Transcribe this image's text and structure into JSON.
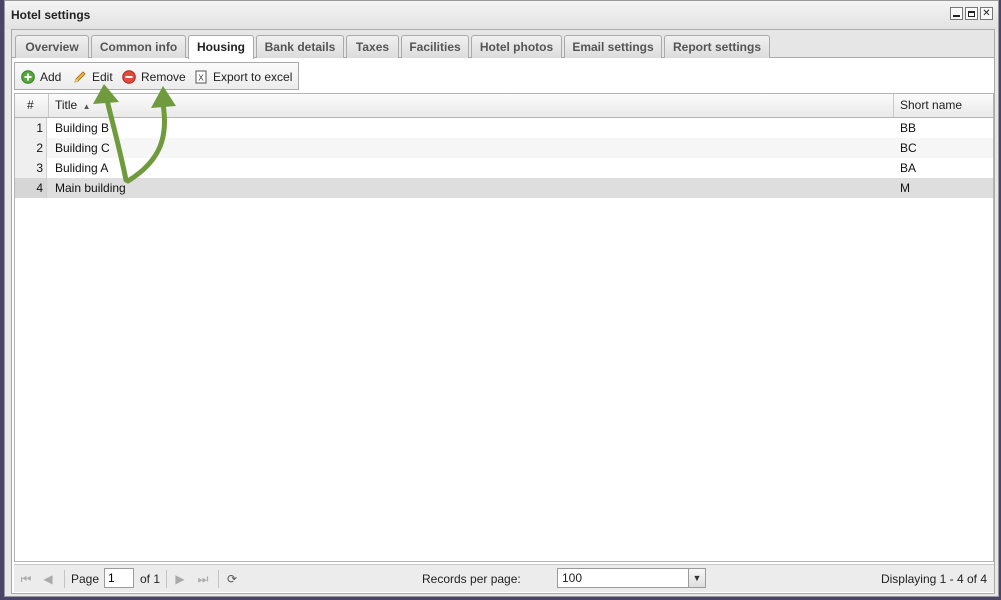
{
  "window": {
    "title": "Hotel settings"
  },
  "tabs": [
    {
      "label": "Overview"
    },
    {
      "label": "Common info"
    },
    {
      "label": "Housing",
      "active": true
    },
    {
      "label": "Bank details"
    },
    {
      "label": "Taxes"
    },
    {
      "label": "Facilities"
    },
    {
      "label": "Hotel photos"
    },
    {
      "label": "Email settings"
    },
    {
      "label": "Report settings"
    }
  ],
  "toolbar": {
    "add_label": "Add",
    "edit_label": "Edit",
    "remove_label": "Remove",
    "export_label": "Export to excel"
  },
  "grid": {
    "columns": {
      "num": "#",
      "title": "Title",
      "short": "Short name"
    },
    "sort": {
      "column": "Title",
      "direction": "ascending"
    },
    "rows": [
      {
        "num": "1",
        "title": "Building B",
        "short": "BB"
      },
      {
        "num": "2",
        "title": "Building C",
        "short": "BC"
      },
      {
        "num": "3",
        "title": "Buliding A",
        "short": "BA"
      },
      {
        "num": "4",
        "title": "Main building",
        "short": "M",
        "selected": true
      }
    ]
  },
  "pager": {
    "page_label": "Page",
    "page_value": "1",
    "of_label": "of 1",
    "records_label": "Records per page:",
    "records_value": "100",
    "displaying": "Displaying 1 - 4 of 4"
  },
  "annotation": {
    "arrow_color": "#6f9a3d"
  }
}
